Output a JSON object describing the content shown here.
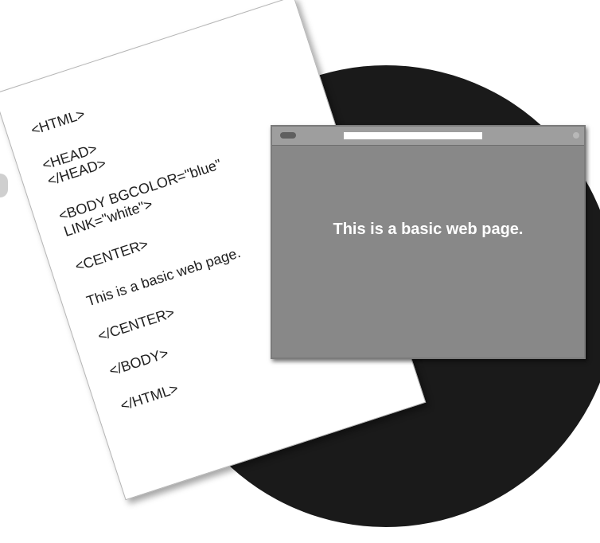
{
  "source_document": {
    "lines": [
      "<HTML>",
      "<HEAD>\n</HEAD>",
      "<BODY BGCOLOR=\"blue\"\nLINK=\"white\">",
      "<CENTER>",
      "This is a basic web page.",
      "</CENTER>",
      "</BODY>",
      "</HTML>"
    ]
  },
  "browser_window": {
    "content_text": "This is a basic web page."
  },
  "colors": {
    "background_circle": "#1a1a1a",
    "browser_content": "#888888",
    "browser_titlebar": "#9e9e9e",
    "paper": "#ffffff",
    "rendered_text": "#ffffff"
  }
}
